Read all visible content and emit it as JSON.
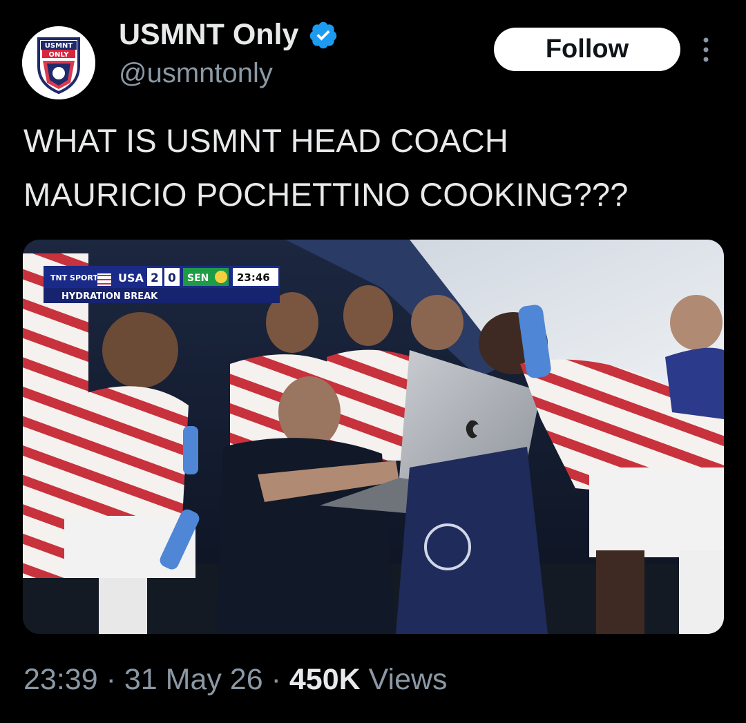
{
  "header": {
    "display_name": "USMNT Only",
    "handle": "@usmntonly",
    "follow_label": "Follow",
    "avatar_logo_text": [
      "USMNT",
      "ONLY"
    ]
  },
  "tweet": {
    "text_lines": [
      "WHAT IS USMNT HEAD COACH",
      "MAURICIO POCHETTINO COOKING???"
    ]
  },
  "media": {
    "scorebug": {
      "network": "TNT SPORTS",
      "team_home": "USA",
      "score_home": "2",
      "score_away": "0",
      "team_away": "SEN",
      "clock": "23:46",
      "status": "HYDRATION BREAK"
    }
  },
  "meta": {
    "time": "23:39",
    "separator": "·",
    "date": "31 May 26",
    "views_count": "450K",
    "views_label": "Views"
  },
  "colors": {
    "background": "#000000",
    "text_primary": "#e7e9ea",
    "text_secondary": "#8b98a5",
    "verified_blue": "#1d9bf0",
    "follow_bg": "#ffffff"
  },
  "icons": {
    "verified": "verified-badge-icon",
    "more": "more-vertical-icon"
  }
}
